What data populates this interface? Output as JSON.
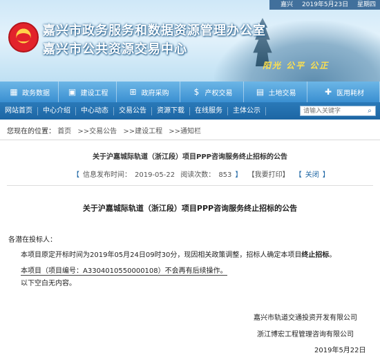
{
  "header": {
    "date_text": "嘉兴",
    "date": "2019年5月23日",
    "weekday": "星期四",
    "title_line1": "嘉兴市政务服务和数据资源管理办公室",
    "title_line2": "嘉兴市公共资源交易中心",
    "slogan": "阳光 公平 公正"
  },
  "main_menu": [
    {
      "label": "政务数据",
      "icon": "grid-icon"
    },
    {
      "label": "建设工程",
      "icon": "building-icon"
    },
    {
      "label": "政府采购",
      "icon": "cart-icon"
    },
    {
      "label": "产权交易",
      "icon": "dollar-icon"
    },
    {
      "label": "土地交易",
      "icon": "land-icon"
    },
    {
      "label": "医用耗材",
      "icon": "plus-icon"
    }
  ],
  "sub_nav": {
    "items": [
      "网站首页",
      "中心介绍",
      "中心动态",
      "交易公告",
      "资源下载",
      "在线服务",
      "主体公示"
    ],
    "search_placeholder": "请输入关键字"
  },
  "breadcrumb": {
    "prefix": "您现在的位置：",
    "items": [
      "首页",
      ">>交易公告",
      ">>建设工程",
      ">>通知栏"
    ]
  },
  "article": {
    "header_title": "关于沪嘉城际轨道（浙江段）项目PPP咨询服务终止招标的公告",
    "publish_time_label": "信息发布时间：",
    "publish_time": "2019-05-22",
    "views_label": "阅读次数：",
    "views": "853",
    "print_label": "【我要打印】",
    "close_label": "关闭",
    "title": "关于沪嘉城际轨道（浙江段）项目PPP咨询服务终止招标的公告",
    "salutation": "各潜在投标人：",
    "para1_a": "本项目原定开标时间为2019年05月24日09时30分，现因相关政策调整，招标人确定本项目",
    "para1_b": "终止招标",
    "para1_c": "。",
    "para2": "本项目（项目编号：A3304010550000108）不会再有后续操作。",
    "para3": "以下空白无内容。",
    "signer1": "嘉兴市轨道交通投资开发有限公司",
    "signer2": "浙江博宏工程管理咨询有限公司",
    "sign_date": "2019年5月22日"
  },
  "colors": {
    "menu_blue": "#3a8fd1",
    "subnav_blue": "#1d66a4",
    "link_blue": "#1d66a4"
  }
}
